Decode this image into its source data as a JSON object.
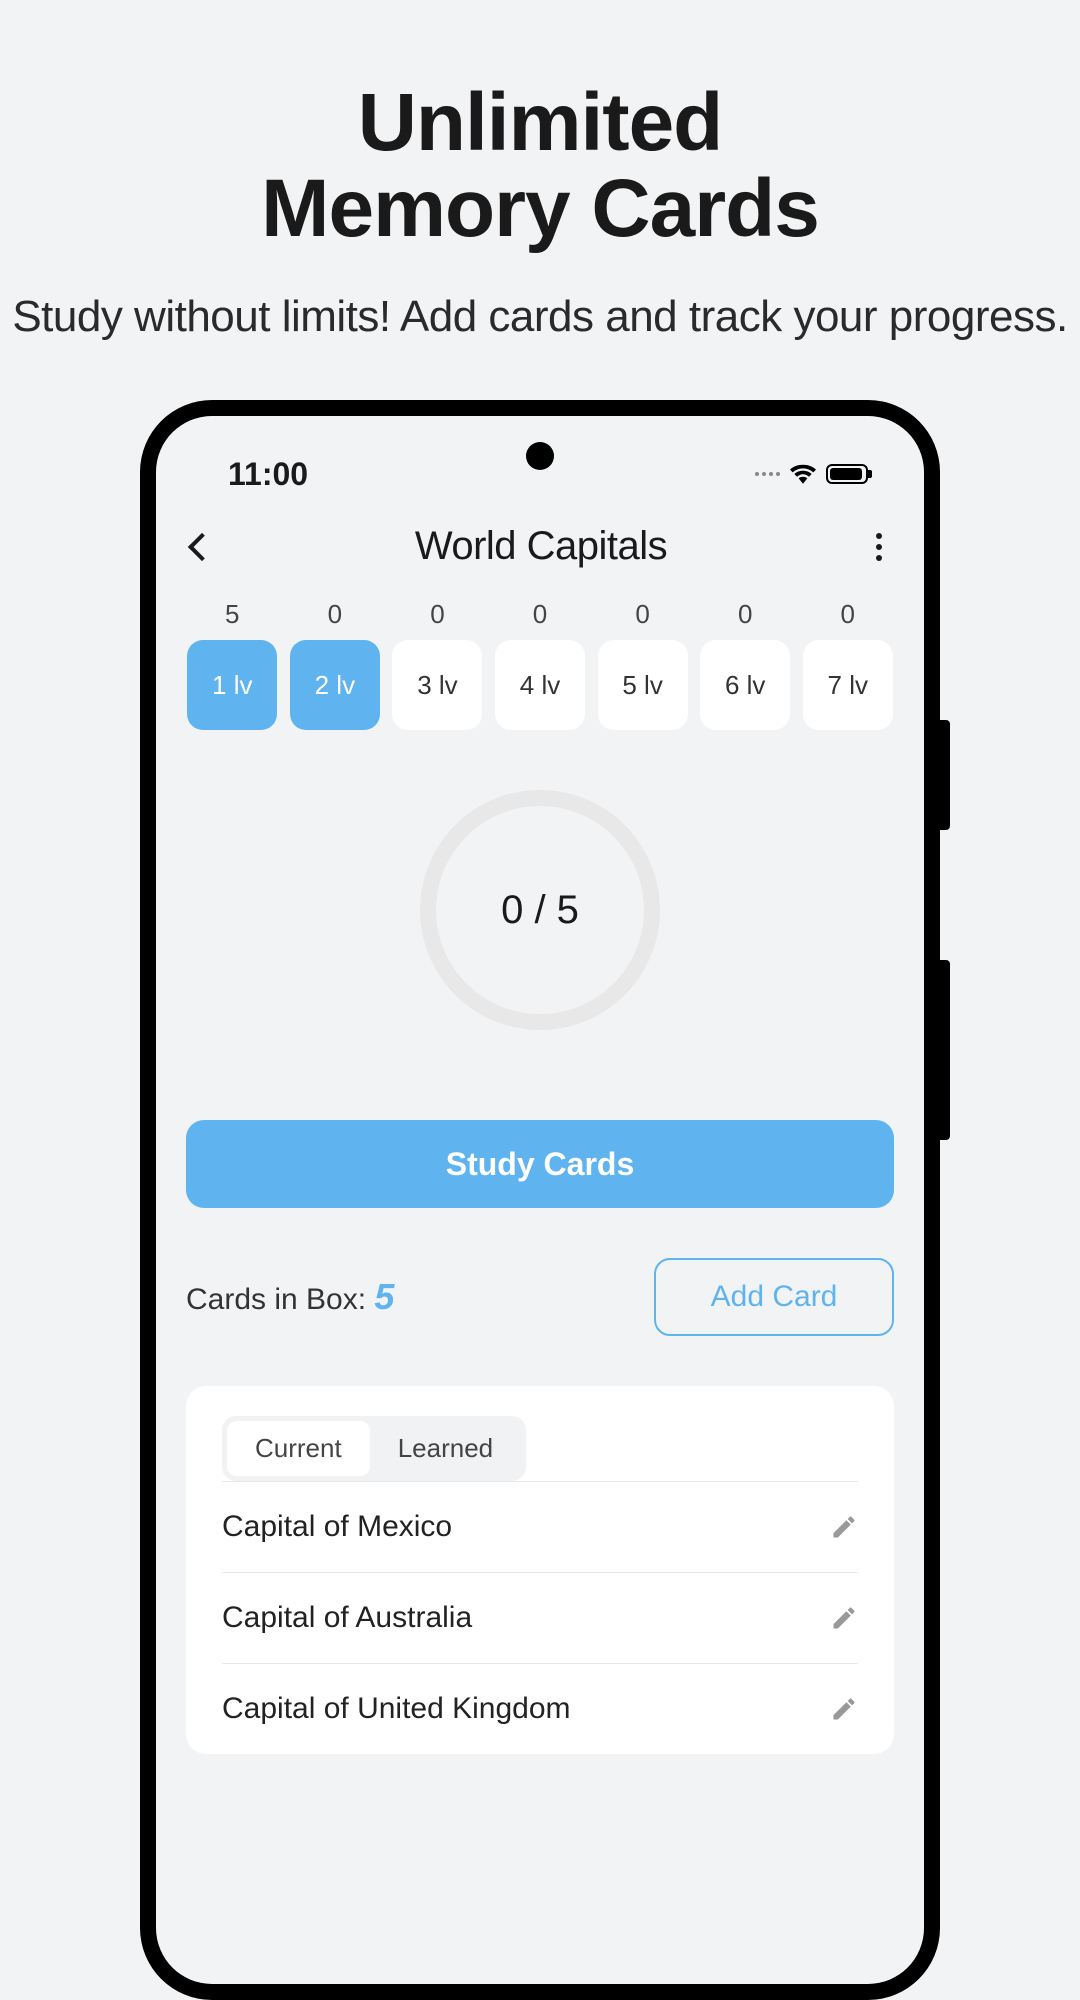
{
  "promo": {
    "title_line1": "Unlimited",
    "title_line2": "Memory Cards",
    "subtitle": "Study without limits! Add cards and track your progress."
  },
  "status": {
    "time": "11:00"
  },
  "header": {
    "title": "World Capitals"
  },
  "levels": [
    {
      "count": "5",
      "label": "1 lv",
      "active": true
    },
    {
      "count": "0",
      "label": "2 lv",
      "active": true
    },
    {
      "count": "0",
      "label": "3 lv",
      "active": false
    },
    {
      "count": "0",
      "label": "4 lv",
      "active": false
    },
    {
      "count": "0",
      "label": "5 lv",
      "active": false
    },
    {
      "count": "0",
      "label": "6 lv",
      "active": false
    },
    {
      "count": "0",
      "label": "7 lv",
      "active": false
    }
  ],
  "progress": {
    "text": "0 / 5"
  },
  "study_btn": "Study Cards",
  "box": {
    "label": "Cards in Box: ",
    "count": "5",
    "add_btn": "Add Card"
  },
  "tabs": {
    "current": "Current",
    "learned": "Learned"
  },
  "cards": [
    {
      "title": "Capital of Mexico"
    },
    {
      "title": "Capital of Australia"
    },
    {
      "title": "Capital of United Kingdom"
    }
  ]
}
